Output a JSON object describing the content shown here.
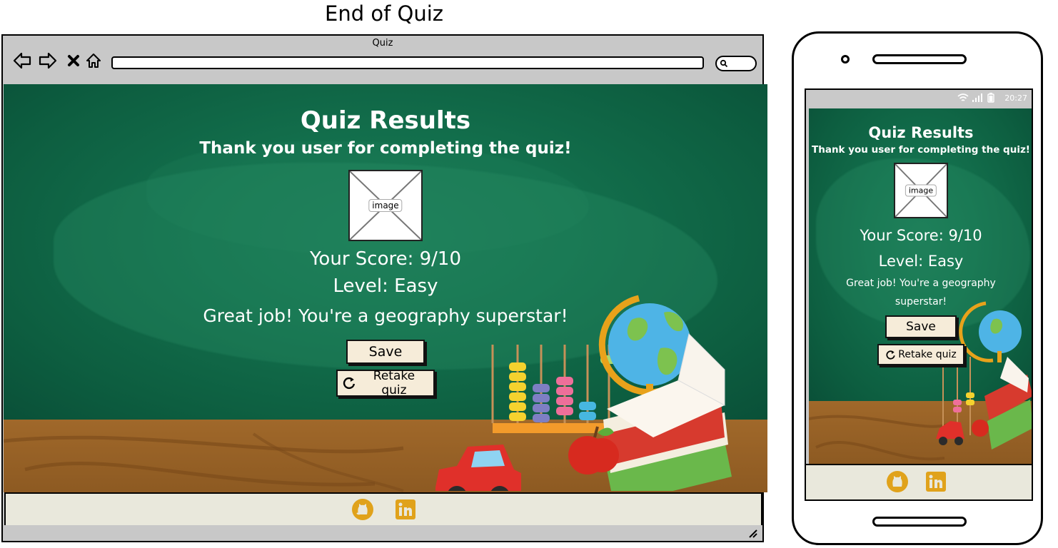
{
  "page_title": "End of Quiz",
  "browser": {
    "tab_title": "Quiz",
    "nav_icons": [
      "back-arrow-icon",
      "forward-arrow-icon",
      "close-x-icon",
      "home-icon"
    ],
    "address_value": "",
    "search_icon": "search-icon"
  },
  "quiz": {
    "title": "Quiz Results",
    "thanks": "Thank you user for completing the quiz!",
    "image_label": "image",
    "score": "Your Score: 9/10",
    "level": "Level: Easy",
    "message": "Great job! You're a geography superstar!",
    "save_label": "Save",
    "retake_label": "Retake quiz",
    "retake_icon": "refresh-icon"
  },
  "footer": {
    "icons": [
      "github-icon",
      "linkedin-icon"
    ],
    "icon_color": "#e0a21b"
  },
  "phone": {
    "status_time": "20:27",
    "status_icons": [
      "wifi-icon",
      "signal-icon",
      "battery-icon"
    ]
  },
  "colors": {
    "board_green": "#0b5a3d",
    "desk_brown": "#a0682a",
    "button_bg": "#f6ecd9",
    "footer_bg": "#e9e8dc",
    "chrome_gray": "#c8c8c8"
  }
}
